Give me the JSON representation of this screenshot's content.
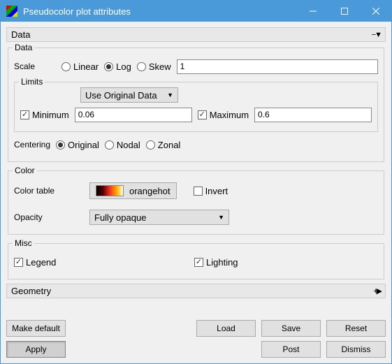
{
  "title": "Pseudocolor plot attributes",
  "sections": {
    "data": {
      "label": "Data",
      "arrow": "−▼"
    },
    "geometry": {
      "label": "Geometry",
      "arrow": "+▶"
    }
  },
  "data_group": {
    "title": "Data",
    "scale_label": "Scale",
    "scale_options": {
      "linear": "Linear",
      "log": "Log",
      "skew": "Skew"
    },
    "skew_value": "1",
    "limits_label": "Limits",
    "limits_mode": "Use Original Data",
    "minimum_label": "Minimum",
    "minimum_value": "0.06",
    "maximum_label": "Maximum",
    "maximum_value": "0.6",
    "centering_label": "Centering",
    "centering_options": {
      "original": "Original",
      "nodal": "Nodal",
      "zonal": "Zonal"
    }
  },
  "color_group": {
    "title": "Color",
    "colortable_label": "Color table",
    "colortable_name": "orangehot",
    "invert_label": "Invert",
    "opacity_label": "Opacity",
    "opacity_value": "Fully opaque"
  },
  "misc_group": {
    "title": "Misc",
    "legend_label": "Legend",
    "lighting_label": "Lighting"
  },
  "buttons": {
    "make_default": "Make default",
    "apply": "Apply",
    "load": "Load",
    "save": "Save",
    "reset": "Reset",
    "post": "Post",
    "dismiss": "Dismiss"
  }
}
